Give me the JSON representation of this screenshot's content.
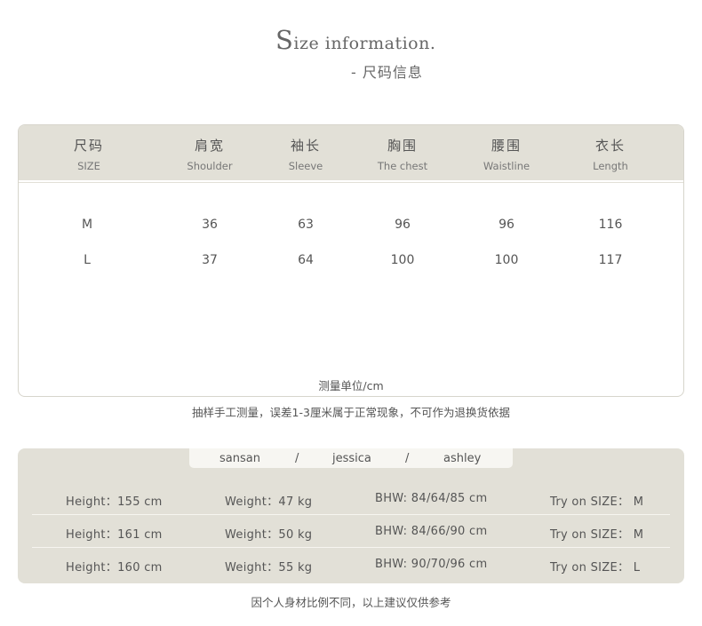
{
  "header": {
    "title_initial": "S",
    "title_rest": "ize information.",
    "subtitle": "- 尺码信息"
  },
  "size_table": {
    "columns": [
      {
        "cn": "尺码",
        "en": "SIZE"
      },
      {
        "cn": "肩宽",
        "en": "Shoulder"
      },
      {
        "cn": "袖长",
        "en": "Sleeve"
      },
      {
        "cn": "胸围",
        "en": "The chest"
      },
      {
        "cn": "腰围",
        "en": "Waistline"
      },
      {
        "cn": "衣长",
        "en": "Length"
      }
    ],
    "rows": [
      [
        "M",
        "36",
        "63",
        "96",
        "96",
        "116"
      ],
      [
        "L",
        "37",
        "64",
        "100",
        "100",
        "117"
      ]
    ],
    "unit": "测量单位/cm"
  },
  "note_measure": "抽样手工测量，误差1-3厘米属于正常现象，不可作为退换货依据",
  "models": {
    "names": [
      "sansan",
      "jessica",
      "ashley"
    ],
    "separator": "/",
    "rows": [
      {
        "height": "Height：155 cm",
        "weight": "Weight：47 kg",
        "bhw": "BHW: 84/64/85 cm",
        "size": "Try on SIZE：  M"
      },
      {
        "height": "Height：161 cm",
        "weight": "Weight：50 kg",
        "bhw": "BHW: 84/66/90 cm",
        "size": "Try on SIZE：  M"
      },
      {
        "height": "Height：160 cm",
        "weight": "Weight：55 kg",
        "bhw": "BHW: 90/70/96 cm",
        "size": "Try on SIZE：  L"
      }
    ]
  },
  "note_reference": "因个人身材比例不同，以上建议仅供参考"
}
